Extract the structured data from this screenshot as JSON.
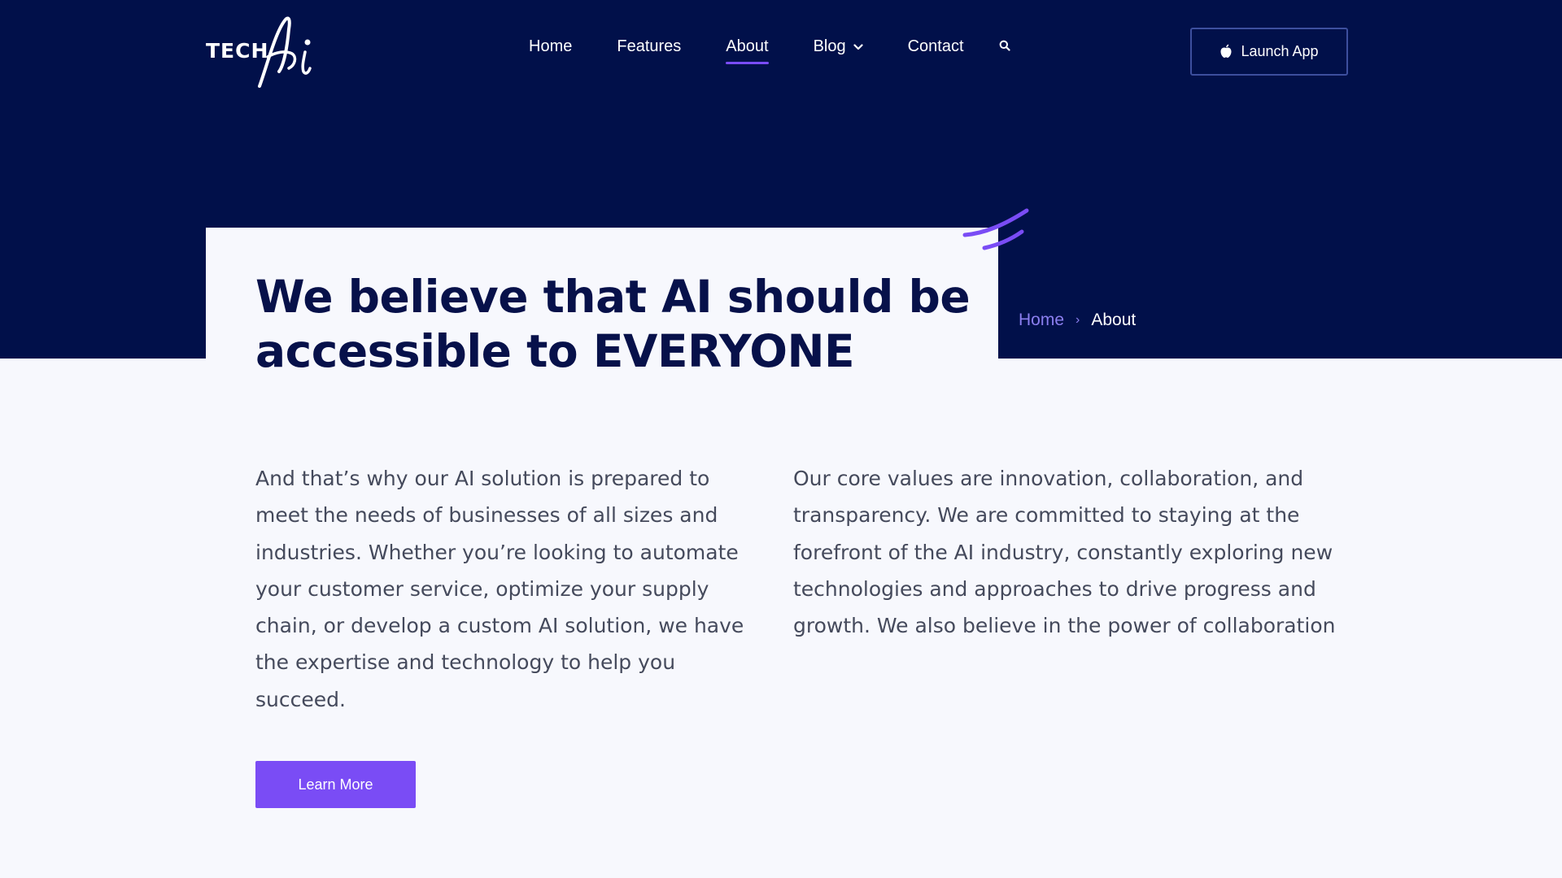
{
  "brand": {
    "logo_text": "TECH",
    "logo_script": "Ai"
  },
  "nav": {
    "items": [
      {
        "label": "Home"
      },
      {
        "label": "Features"
      },
      {
        "label": "About",
        "active": true
      },
      {
        "label": "Blog",
        "has_dropdown": true
      },
      {
        "label": "Contact"
      }
    ],
    "search_icon": "search-icon"
  },
  "header_cta": {
    "label": "Launch App",
    "icon": "apple-icon"
  },
  "hero": {
    "title": "We believe that AI should be accessible to EVERYONE"
  },
  "breadcrumb": {
    "home": "Home",
    "separator": "›",
    "current": "About"
  },
  "content": {
    "left_paragraph": "And that’s why our AI solution is prepared to meet the needs of businesses of all sizes and industries. Whether you’re looking to automate your customer service, optimize your supply chain, or develop a custom AI solution, we have the expertise and technology to help you succeed.",
    "right_paragraph": "Our core values are innovation, collaboration, and transparency. We are committed to staying at the forefront of the AI industry, constantly exploring new technologies and approaches to drive progress and growth. We also believe in the power of collaboration",
    "cta_label": "Learn More"
  },
  "colors": {
    "hero_bg": "#01104a",
    "page_bg": "#f7f8fd",
    "accent": "#7a4cf5",
    "title": "#07114a",
    "body_text": "#454a5c",
    "breadcrumb_link": "#8b7ff0"
  }
}
